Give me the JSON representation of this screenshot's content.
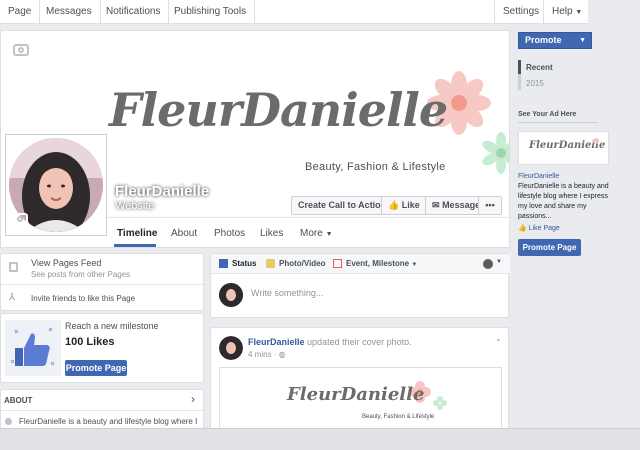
{
  "topbar": {
    "items": [
      "Page",
      "Messages",
      "Notifications",
      "Publishing Tools"
    ],
    "settings": "Settings",
    "help": "Help"
  },
  "cover": {
    "brand": "FleurDanielle",
    "tagline": "Beauty, Fashion & Lifestyle"
  },
  "profile": {
    "name": "FleurDanielle",
    "category": "Website"
  },
  "actions": {
    "cta": "Create Call to Action",
    "like": "Like",
    "message": "Message",
    "more": "•••"
  },
  "tabs": [
    "Timeline",
    "About",
    "Photos",
    "Likes",
    "More"
  ],
  "left": {
    "feed_title": "View Pages Feed",
    "feed_sub": "See posts from other Pages",
    "invite": "Invite friends to like this Page",
    "milestone_title": "Reach a new milestone",
    "milestone_count": "100 Likes",
    "promote_btn": "Promote Page",
    "about_header": "ABOUT",
    "about_text": "FleurDanielle is a beauty and lifestyle blog where I"
  },
  "composer": {
    "tabs": [
      "Status",
      "Photo/Video",
      "Event, Milestone"
    ],
    "placeholder": "Write something..."
  },
  "post": {
    "author": "FleurDanielle",
    "action": "updated their cover photo.",
    "time": "4 mins",
    "preview_brand": "FleurDanielle",
    "preview_tagline": "Beauty, Fashion & Lifestyle"
  },
  "rail": {
    "promote": "Promote",
    "years": [
      "Recent",
      "2015"
    ],
    "ad_header": "See Your Ad Here",
    "ad_brand": "FleurDanielle",
    "ad_name": "FleurDanielle",
    "ad_text": "FleurDanielle is a beauty and lifestyle blog where I express my love and share my passions...",
    "ad_like": "Like Page",
    "ad_promote": "Promote Page"
  },
  "colors": {
    "fb_blue": "#4267b2",
    "link": "#365899",
    "background": "#e9ebee"
  }
}
